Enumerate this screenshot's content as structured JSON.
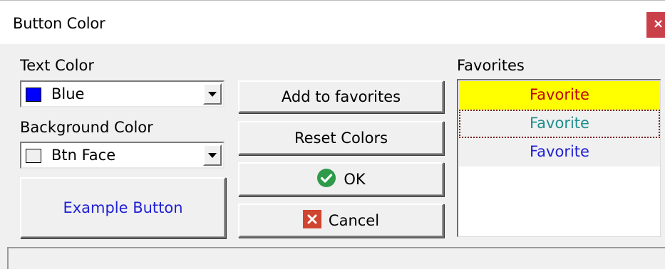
{
  "window": {
    "title": "Button Color",
    "close_glyph": "×"
  },
  "text_color": {
    "label": "Text Color",
    "selected": "Blue",
    "swatch": "#0000ff"
  },
  "background_color": {
    "label": "Background Color",
    "selected": "Btn Face",
    "swatch": "#f0f0f0"
  },
  "example_button": {
    "label": "Example Button",
    "color": "#1f1fd6"
  },
  "actions": {
    "add_favorites": "Add to favorites",
    "reset_colors": "Reset Colors",
    "ok": "OK",
    "cancel": "Cancel"
  },
  "favorites": {
    "label": "Favorites",
    "items": [
      {
        "text": "Favorite",
        "fg": "#c00000",
        "bg": "#ffff00",
        "selected": true
      },
      {
        "text": "Favorite",
        "fg": "#1f8f8f",
        "bg": "#f0f0f0",
        "focused": true
      },
      {
        "text": "Favorite",
        "fg": "#1f1fd6",
        "bg": "#f0f0f0"
      }
    ]
  },
  "icons": {
    "ok": "check-circle-icon",
    "cancel": "x-box-icon",
    "dropdown": "chevron-down-icon"
  },
  "colors": {
    "ok_green": "#2e9a4a",
    "cancel_red": "#d0452f",
    "close_red": "#c9404a"
  }
}
